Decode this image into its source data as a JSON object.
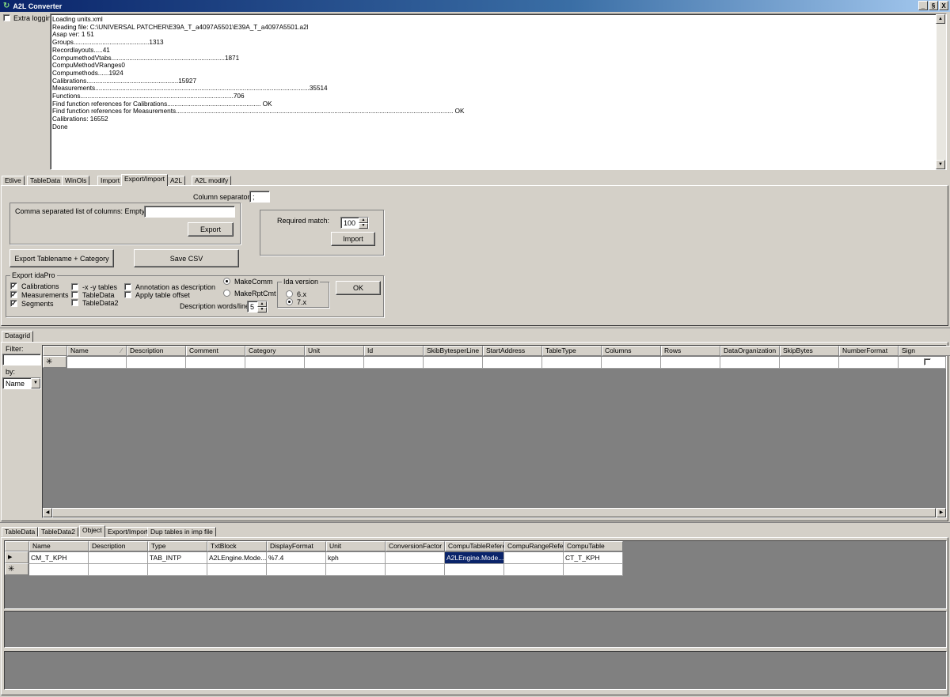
{
  "window": {
    "title": "A2L Converter",
    "minimize": "_",
    "restore": "§",
    "close": "X"
  },
  "extra_logging_label": "Extra logging",
  "log_lines": [
    "Loading units.xml",
    "Reading file: C:\\UNIVERSAL PATCHER\\E39A_T_a4097A5501\\E39A_T_a4097A5501.a2l",
    "Asap ver: 1 51",
    "Groups..........................................1313",
    "Recordlayouts.....41",
    "CompumethodVtabs...............................................................1871",
    "CompuMethodVRanges0",
    "Compumethods......1924",
    "Calibrations...................................................15927",
    "Measurements.......................................................................................................................35514",
    "Functions.....................................................................................706",
    "Find function references for Calibrations.................................................... OK",
    "Find function references for Measurements.......................................................................................................................................................... OK",
    "Calibrations: 16552",
    "Done"
  ],
  "top_tabs": [
    "Etlive",
    "TableData",
    "WinOls",
    "Import",
    "Export/Import",
    "A2L",
    "A2L modify"
  ],
  "top_tab_active": "Export/Import",
  "export_import": {
    "column_separator_label": "Column separator:",
    "column_separator_value": ";",
    "columns_label": "Comma separated list of columns: Empty = All",
    "columns_value": "",
    "export_button": "Export",
    "required_match_label": "Required match:",
    "required_match_value": "100",
    "import_button": "Import",
    "export_tablename_button": "Export Tablename + Category",
    "save_csv_button": "Save CSV"
  },
  "idapro": {
    "group_title": "Export idaPro",
    "calibrations": "Calibrations",
    "measurements": "Measurements",
    "segments": "Segments",
    "xy_tables": "-x -y tables",
    "tabledata": "TableData",
    "tabledata2": "TableData2",
    "annotation": "Annotation as description",
    "apply_offset": "Apply table offset",
    "makecomm": "MakeComm",
    "makerptcmt": "MakeRptCmt",
    "desc_words_label": "Description words/line",
    "desc_words_value": "5",
    "ida_version_title": "Ida version",
    "v6": "6.x",
    "v7": "7.x",
    "ok_button": "OK"
  },
  "datagrid": {
    "tab": "Datagrid",
    "filter_label": "Filter:",
    "filter_value": "",
    "by_label": "by:",
    "by_value": "Name",
    "columns": [
      "Name",
      "Description",
      "Comment",
      "Category",
      "Unit",
      "Id",
      "SkibBytesperLine",
      "StartAddress",
      "TableType",
      "Columns",
      "Rows",
      "DataOrganization",
      "SkipBytes",
      "NumberFormat",
      "Sign"
    ],
    "new_row_marker": "✳"
  },
  "bottom_tabs": [
    "TableData",
    "TableData2",
    "Object",
    "Export/Import",
    "Dup tables in imp file"
  ],
  "bottom_tab_active": "Object",
  "object_grid": {
    "columns": [
      "Name",
      "Description",
      "Type",
      "TxtBlock",
      "DisplayFormat",
      "Unit",
      "ConversionFactor",
      "CompuTableRefere",
      "CompuRangeRefer",
      "CompuTable"
    ],
    "row": [
      "CM_T_KPH",
      "",
      "TAB_INTP",
      "A2LEngine.Mode...",
      "%7.4",
      "kph",
      "",
      "A2LEngine.Mode...",
      "",
      "CT_T_KPH"
    ],
    "current_row_marker": "▶",
    "new_row_marker": "✳"
  }
}
